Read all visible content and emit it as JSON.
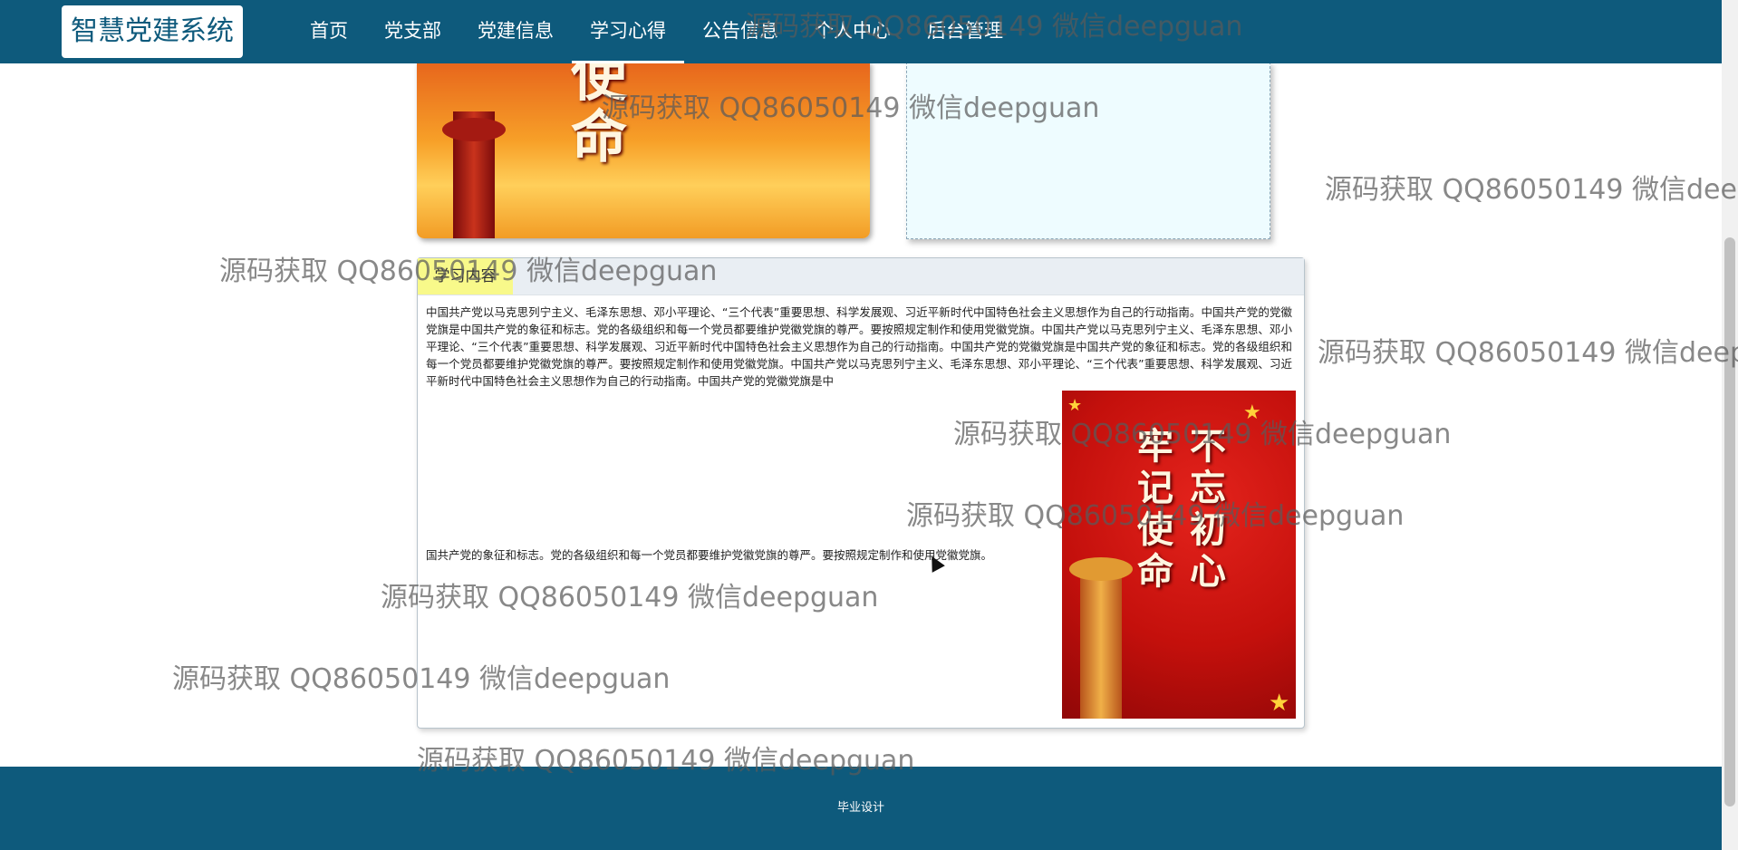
{
  "app": {
    "brand": "智慧党建系统"
  },
  "nav": {
    "items": [
      "首页",
      "党支部",
      "党建信息",
      "学习心得",
      "公告信息",
      "个人中心",
      "后台管理"
    ],
    "active_index": 3
  },
  "top_poster": {
    "slogan": "使命"
  },
  "content": {
    "tab_label": "学习内容",
    "body_text": "中国共产党以马克思列宁主义、毛泽东思想、邓小平理论、“三个代表”重要思想、科学发展观、习近平新时代中国特色社会主义思想作为自己的行动指南。中国共产党的党徽党旗是中国共产党的象征和标志。党的各级组织和每一个党员都要维护党徽党旗的尊严。要按照规定制作和使用党徽党旗。中国共产党以马克思列宁主义、毛泽东思想、邓小平理论、“三个代表”重要思想、科学发展观、习近平新时代中国特色社会主义思想作为自己的行动指南。中国共产党的党徽党旗是中国共产党的象征和标志。党的各级组织和每一个党员都要维护党徽党旗的尊严。要按照规定制作和使用党徽党旗。中国共产党以马克思列宁主义、毛泽东思想、邓小平理论、“三个代表”重要思想、科学发展观、习近平新时代中国特色社会主义思想作为自己的行动指南。中国共产党的党徽党旗是中",
    "body_text_tail": "国共产党的象征和标志。党的各级组织和每一个党员都要维护党徽党旗的尊严。要按照规定制作和使用党徽党旗。",
    "side_poster_slogan": "不忘初心 牢记使命"
  },
  "footer": {
    "text": "毕业设计"
  },
  "watermark": {
    "text": "源码获取 QQ86050149 微信deepguan"
  },
  "colors": {
    "primary": "#0e5a7c",
    "tab_highlight": "#f8f98a",
    "panel_head": "#e9eef3"
  }
}
